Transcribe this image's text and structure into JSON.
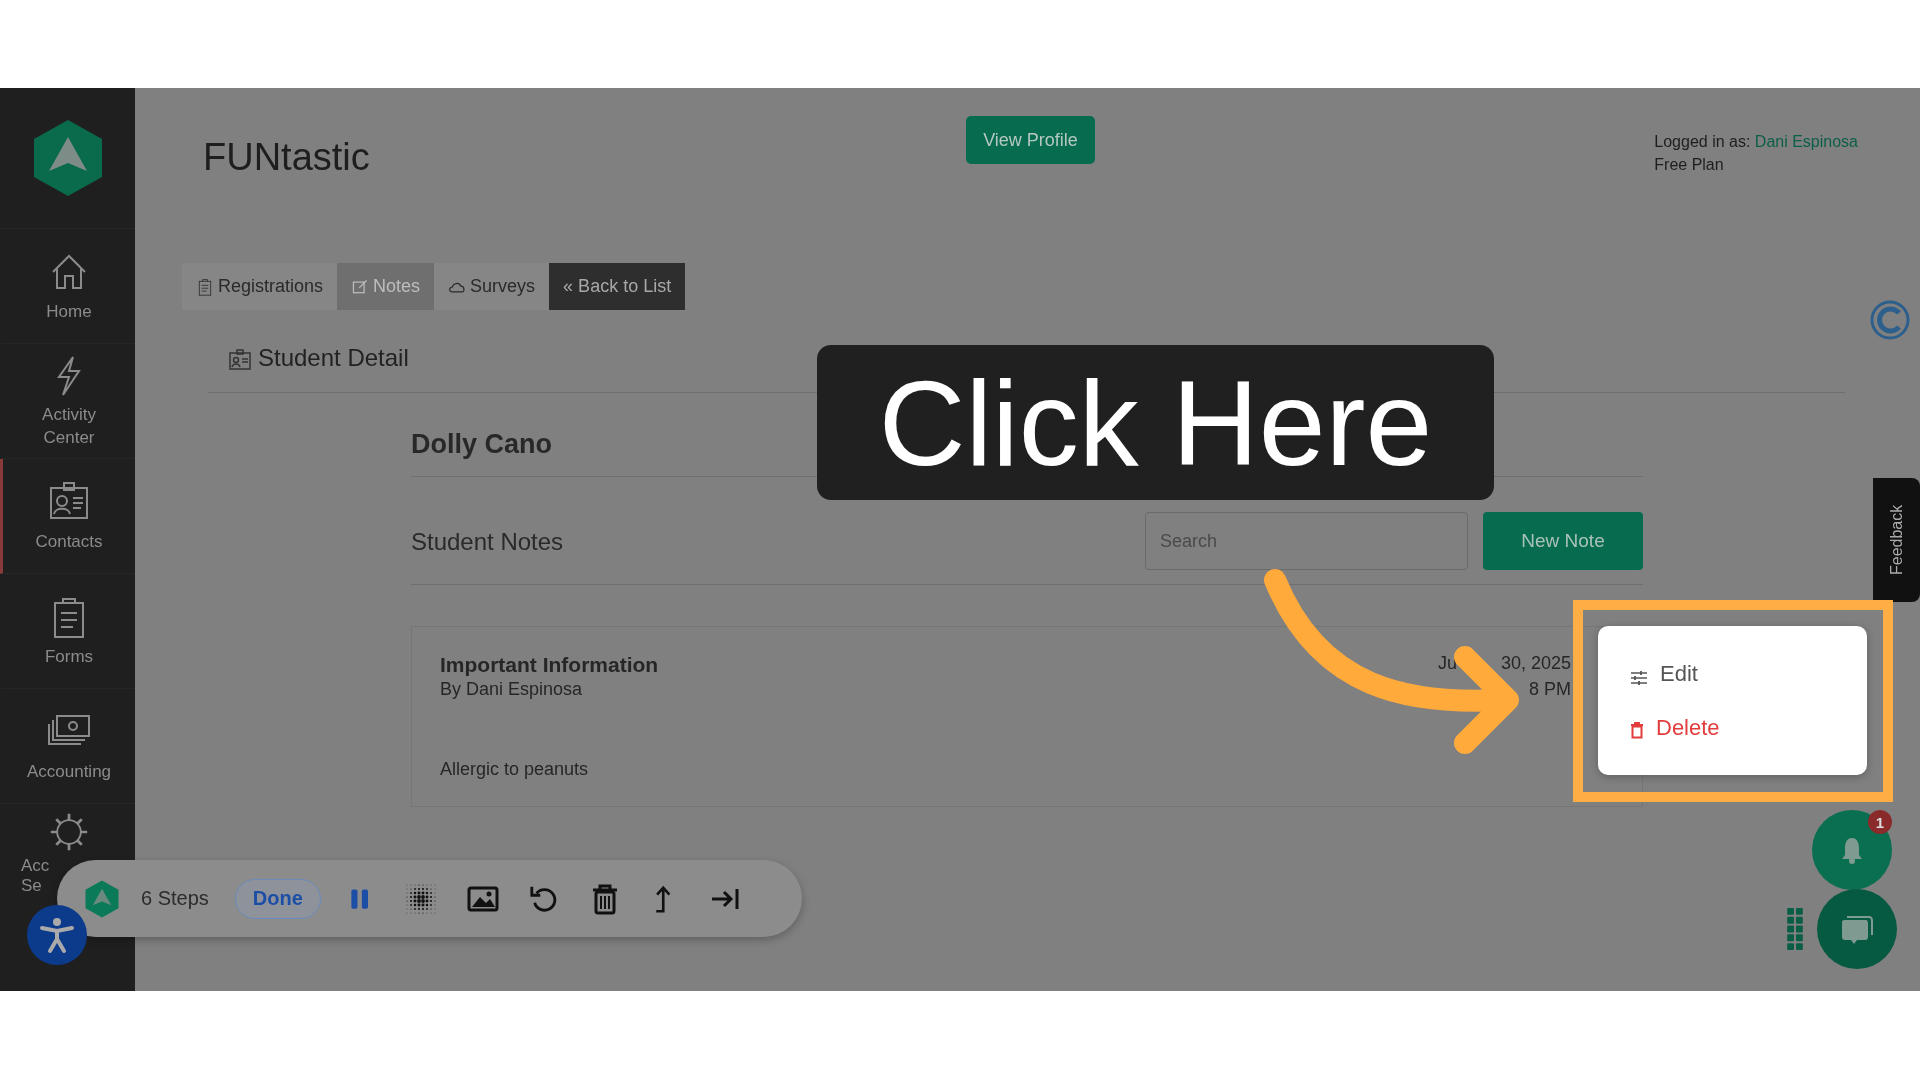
{
  "header": {
    "title": "FUNtastic",
    "view_profile": "View Profile",
    "login_label": "Logged in as:",
    "user": "Dani Espinosa",
    "plan": "Free Plan"
  },
  "sidebar": {
    "items": [
      {
        "lines": [
          "Home"
        ],
        "selected": false
      },
      {
        "lines": [
          "Activity",
          "Center"
        ],
        "selected": false
      },
      {
        "lines": [
          "Contacts"
        ],
        "selected": true
      },
      {
        "lines": [
          "Forms"
        ],
        "selected": false
      },
      {
        "lines": [
          "Accounting"
        ],
        "selected": false
      },
      {
        "lines": [
          "Acc",
          "Se"
        ],
        "selected": false
      }
    ]
  },
  "tabs": [
    {
      "label": "Registrations",
      "kind": "tab",
      "selected": false
    },
    {
      "label": "Notes",
      "kind": "tab",
      "selected": true
    },
    {
      "label": "Surveys",
      "kind": "tab",
      "selected": false
    },
    {
      "label": "« Back to List",
      "kind": "back"
    }
  ],
  "detail": {
    "heading": "Student Detail",
    "student": "Dolly Cano",
    "notes_heading": "Student Notes",
    "search": {
      "placeholder": "Search"
    },
    "new_note": "New Note"
  },
  "notes": [
    {
      "title": "Important Information",
      "author": "By Dani Espinosa",
      "date_start": "Ju",
      "date": "30, 2025",
      "time": "8 PM",
      "body": "Allergic to peanuts"
    }
  ],
  "menu": {
    "items": [
      {
        "label": "Edit",
        "kind": "edit"
      },
      {
        "label": "Delete",
        "kind": "delete"
      }
    ]
  },
  "callout": {
    "text": "Click Here"
  },
  "feedback": "Feedback",
  "notifications": {
    "badge": "1"
  },
  "toolbar": {
    "steps": "6 Steps",
    "done": "Done"
  }
}
